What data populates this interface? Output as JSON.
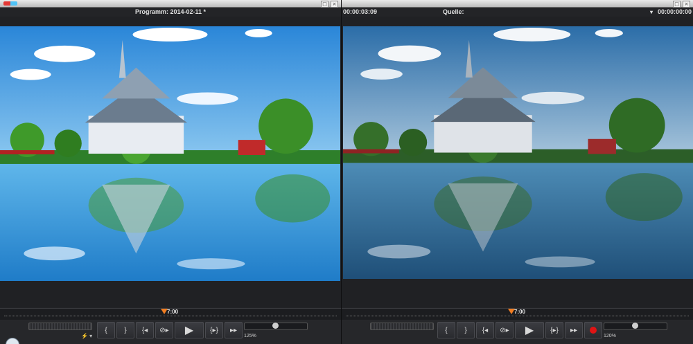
{
  "left_panel": {
    "title": "Programm: 2014-02-11 *",
    "window_buttons": [
      "□",
      "×"
    ],
    "timeline_time": "7:00",
    "zoom": "125%",
    "extra_icon": "⚡ ▾",
    "buttons": [
      "{",
      "}",
      "{◂",
      "⊘▸",
      "▶",
      "{▸}",
      "▸▸"
    ]
  },
  "right_panel": {
    "timecode_left": "00:00:03:09",
    "source_label": "Quelle:",
    "dropdown_arrow": "▾",
    "timecode_right": "00:00:00:00",
    "window_buttons": [
      "□",
      "×"
    ],
    "timeline_time": "7:00",
    "zoom": "120%",
    "buttons": [
      "{",
      "}",
      "{◂",
      "⊘▸",
      "▶",
      "{▸}",
      "▸▸",
      "record"
    ]
  },
  "icons": {
    "record": "record-icon",
    "play": "play-icon"
  },
  "colors": {
    "playhead": "#f07d22",
    "record": "#e01414"
  }
}
